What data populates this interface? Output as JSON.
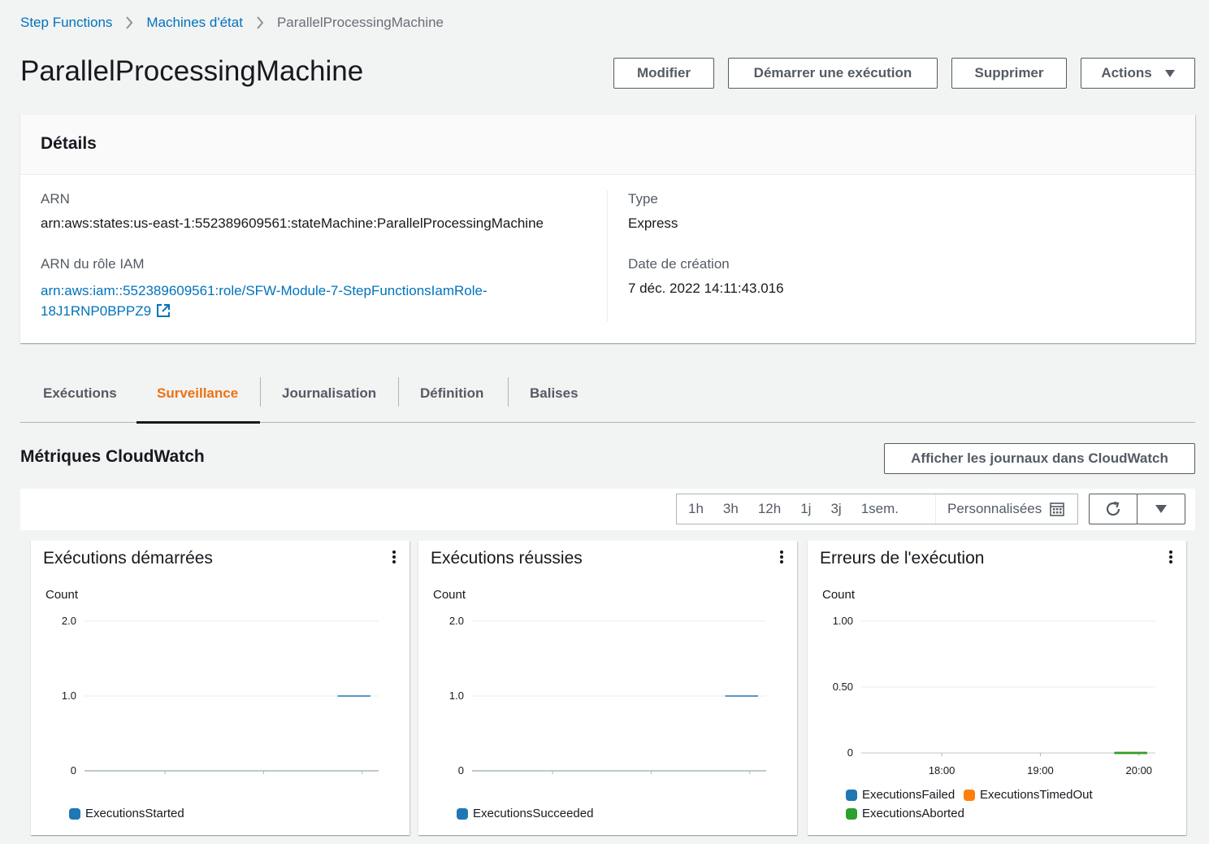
{
  "breadcrumb": {
    "items": [
      "Step Functions",
      "Machines d'état"
    ],
    "current": "ParallelProcessingMachine"
  },
  "page": {
    "title": "ParallelProcessingMachine"
  },
  "header_buttons": {
    "edit": "Modifier",
    "start": "Démarrer une exécution",
    "delete": "Supprimer",
    "actions": "Actions"
  },
  "details": {
    "title": "Détails",
    "arn_label": "ARN",
    "arn_value": "arn:aws:states:us-east-1:552389609561:stateMachine:ParallelProcessingMachine",
    "role_label": "ARN du rôle IAM",
    "role_value": "arn:aws:iam::552389609561:role/SFW-Module-7-StepFunctionsIamRole-18J1RNP0BPPZ9",
    "type_label": "Type",
    "type_value": "Express",
    "created_label": "Date de création",
    "created_value": "7 déc. 2022 14:11:43.016"
  },
  "tabs": [
    "Exécutions",
    "Surveillance",
    "Journalisation",
    "Définition",
    "Balises"
  ],
  "active_tab": "Surveillance",
  "monitoring": {
    "title": "Métriques CloudWatch",
    "logs_button": "Afficher les journaux dans CloudWatch",
    "ranges": [
      "1h",
      "3h",
      "12h",
      "1j",
      "3j",
      "1sem."
    ],
    "custom": "Personnalisées"
  },
  "colors": {
    "accent": "#ec7211",
    "link": "#0073bb",
    "series_blue": "#1f77b4",
    "series_orange": "#ff7f0e",
    "series_green": "#2ca02c"
  },
  "chart_data": [
    {
      "type": "line",
      "title": "Exécutions démarrées",
      "ylabel": "Count",
      "ylim": [
        0,
        2
      ],
      "yticks": [
        "2.0",
        "1.0",
        "0"
      ],
      "xticks": [
        "18:00",
        "19:00",
        "20:00"
      ],
      "series": [
        {
          "name": "ExecutionsStarted",
          "color": "#1f77b4",
          "x": [
            "19:45",
            "20:05"
          ],
          "values": [
            1,
            1
          ]
        }
      ]
    },
    {
      "type": "line",
      "title": "Exécutions réussies",
      "ylabel": "Count",
      "ylim": [
        0,
        2
      ],
      "yticks": [
        "2.0",
        "1.0",
        "0"
      ],
      "xticks": [
        "18:00",
        "19:00",
        "20:00"
      ],
      "series": [
        {
          "name": "ExecutionsSucceeded",
          "color": "#1f77b4",
          "x": [
            "19:45",
            "20:05"
          ],
          "values": [
            1,
            1
          ]
        }
      ]
    },
    {
      "type": "line",
      "title": "Erreurs de l'exécution",
      "ylabel": "Count",
      "ylim": [
        0,
        1
      ],
      "yticks": [
        "1.00",
        "0.50",
        "0"
      ],
      "xticks": [
        "18:00",
        "19:00",
        "20:00"
      ],
      "series": [
        {
          "name": "ExecutionsFailed",
          "color": "#1f77b4",
          "x": [
            "19:45",
            "20:05"
          ],
          "values": [
            0,
            0
          ]
        },
        {
          "name": "ExecutionsTimedOut",
          "color": "#ff7f0e",
          "x": [
            "19:45",
            "20:05"
          ],
          "values": [
            0,
            0
          ]
        },
        {
          "name": "ExecutionsAborted",
          "color": "#2ca02c",
          "x": [
            "19:45",
            "20:05"
          ],
          "values": [
            0,
            0
          ]
        }
      ]
    }
  ]
}
